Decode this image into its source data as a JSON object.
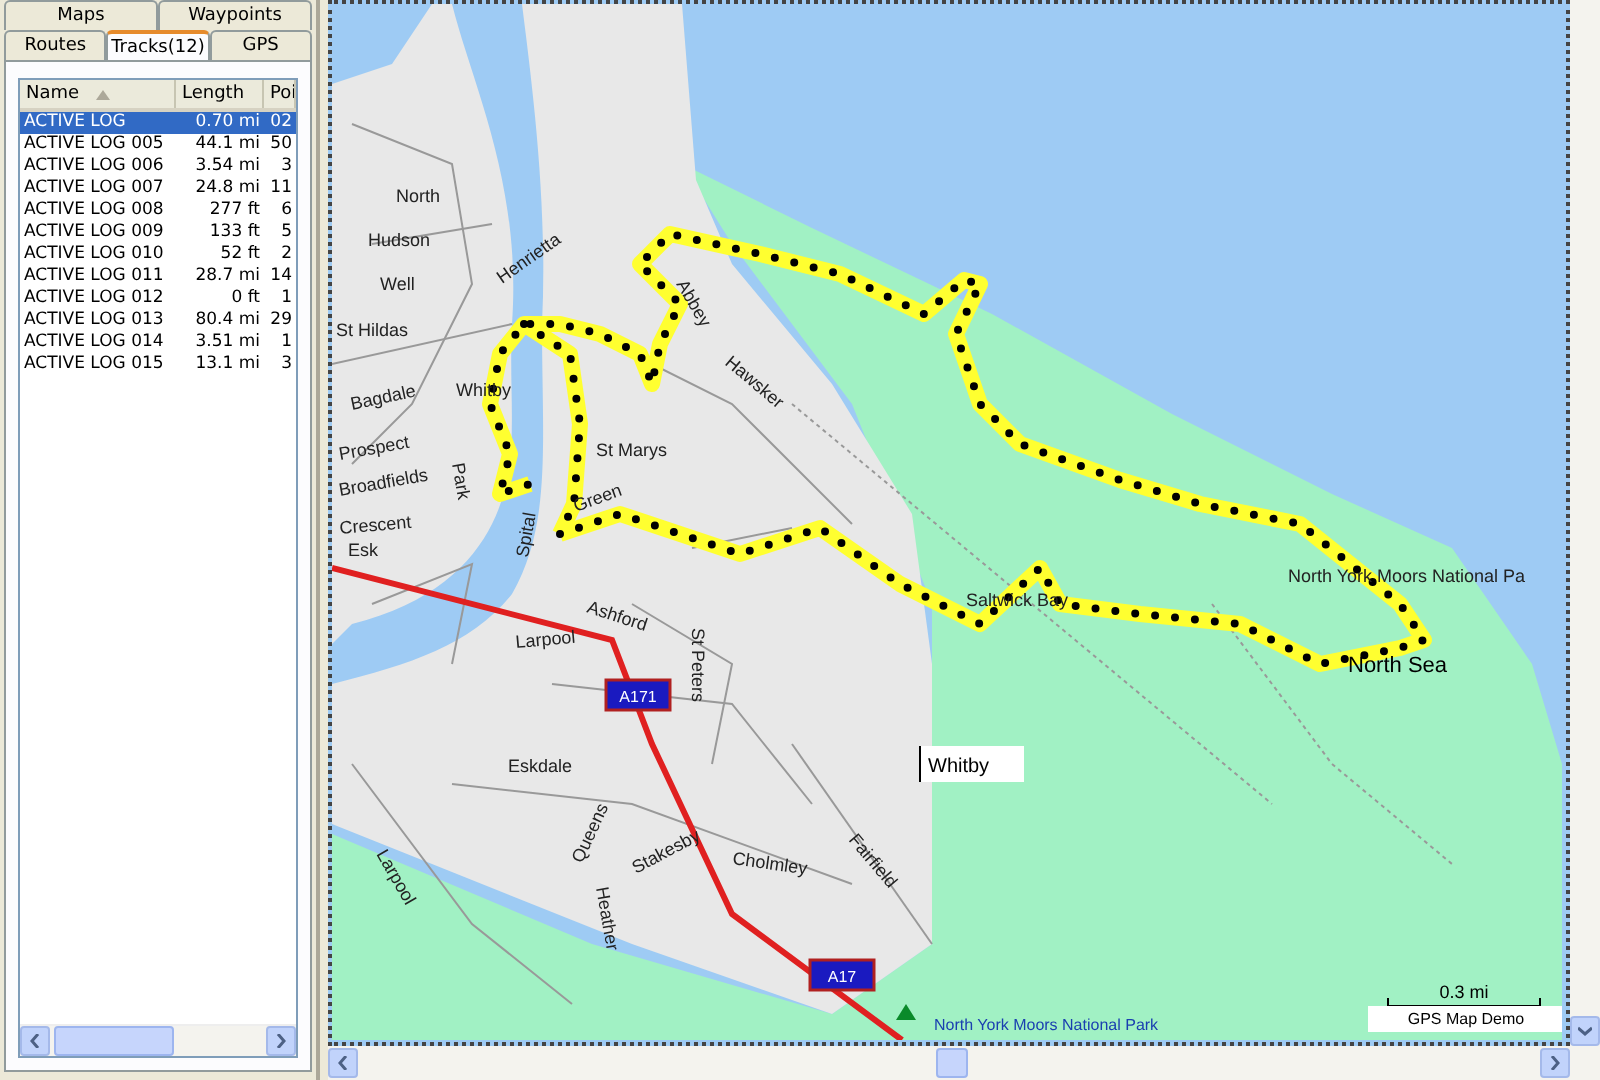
{
  "tabs": [
    {
      "label": "Maps",
      "selected": false
    },
    {
      "label": "Waypoints",
      "selected": false
    },
    {
      "label": "Routes",
      "selected": false
    },
    {
      "label": "Tracks(12)",
      "selected": true
    },
    {
      "label": "GPS",
      "selected": false
    }
  ],
  "track_list": {
    "columns": [
      "Name",
      "Length",
      "Poi"
    ],
    "rows": [
      {
        "name": "ACTIVE LOG",
        "length": "0.70 mi",
        "points": "02",
        "selected": true
      },
      {
        "name": "ACTIVE LOG 005",
        "length": "44.1 mi",
        "points": "50",
        "selected": false
      },
      {
        "name": "ACTIVE LOG 006",
        "length": "3.54 mi",
        "points": "3",
        "selected": false
      },
      {
        "name": "ACTIVE LOG 007",
        "length": "24.8 mi",
        "points": "11",
        "selected": false
      },
      {
        "name": "ACTIVE LOG 008",
        "length": "277 ft",
        "points": "6",
        "selected": false
      },
      {
        "name": "ACTIVE LOG 009",
        "length": "133 ft",
        "points": "5",
        "selected": false
      },
      {
        "name": "ACTIVE LOG 010",
        "length": "52 ft",
        "points": "2",
        "selected": false
      },
      {
        "name": "ACTIVE LOG 011",
        "length": "28.7 mi",
        "points": "14",
        "selected": false
      },
      {
        "name": "ACTIVE LOG 012",
        "length": "0 ft",
        "points": "1",
        "selected": false
      },
      {
        "name": "ACTIVE LOG 013",
        "length": "80.4 mi",
        "points": "29",
        "selected": false
      },
      {
        "name": "ACTIVE LOG 014",
        "length": "3.51 mi",
        "points": "1",
        "selected": false
      },
      {
        "name": "ACTIVE LOG 015",
        "length": "13.1 mi",
        "points": "3",
        "selected": false
      }
    ]
  },
  "map": {
    "labels": [
      {
        "text": "North",
        "kind": "street"
      },
      {
        "text": "Hudson",
        "kind": "street"
      },
      {
        "text": "Well",
        "kind": "street"
      },
      {
        "text": "St Hildas",
        "kind": "street"
      },
      {
        "text": "Henrietta",
        "kind": "street"
      },
      {
        "text": "Abbey",
        "kind": "street"
      },
      {
        "text": "Hawsker",
        "kind": "street"
      },
      {
        "text": "Bagdale",
        "kind": "street"
      },
      {
        "text": "Whitby",
        "kind": "street"
      },
      {
        "text": "Prospect",
        "kind": "street"
      },
      {
        "text": "Broadfields",
        "kind": "street"
      },
      {
        "text": "Park",
        "kind": "street"
      },
      {
        "text": "St Marys",
        "kind": "street"
      },
      {
        "text": "Green",
        "kind": "street"
      },
      {
        "text": "Spital",
        "kind": "street"
      },
      {
        "text": "Crescent",
        "kind": "street"
      },
      {
        "text": "Esk",
        "kind": "street"
      },
      {
        "text": "Saltwick Bay",
        "kind": "street"
      },
      {
        "text": "North York Moors National Pa",
        "kind": "street"
      },
      {
        "text": "North Sea",
        "kind": "place"
      },
      {
        "text": "Ashford",
        "kind": "street"
      },
      {
        "text": "Larpool",
        "kind": "street"
      },
      {
        "text": "St Peters",
        "kind": "street"
      },
      {
        "text": "Eskdale",
        "kind": "street"
      },
      {
        "text": "Whitby",
        "kind": "boxed"
      },
      {
        "text": "Queens",
        "kind": "street"
      },
      {
        "text": "Stakesby",
        "kind": "street"
      },
      {
        "text": "Cholmley",
        "kind": "street"
      },
      {
        "text": "Fairfield",
        "kind": "street"
      },
      {
        "text": "Heather",
        "kind": "street"
      },
      {
        "text": "Larpool",
        "kind": "street"
      },
      {
        "text": "North York Moors National Park",
        "kind": "park"
      }
    ],
    "route_shields": [
      "A171",
      "A17"
    ],
    "scale": "0.3 mi",
    "credit": "GPS Map Demo"
  }
}
